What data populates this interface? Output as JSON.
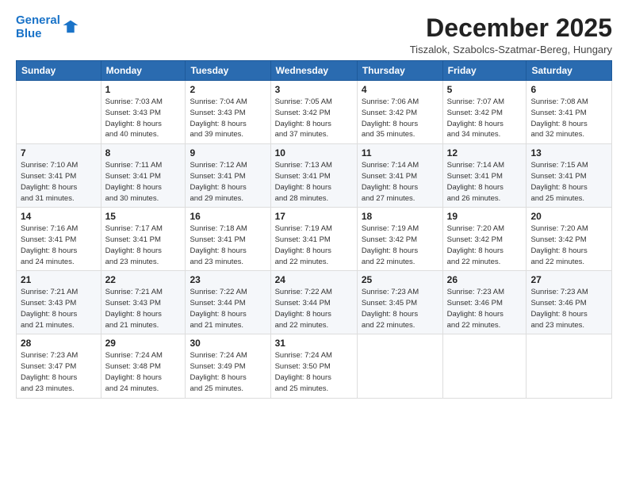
{
  "logo": {
    "line1": "General",
    "line2": "Blue"
  },
  "title": "December 2025",
  "subtitle": "Tiszalok, Szabolcs-Szatmar-Bereg, Hungary",
  "weekdays": [
    "Sunday",
    "Monday",
    "Tuesday",
    "Wednesday",
    "Thursday",
    "Friday",
    "Saturday"
  ],
  "weeks": [
    [
      {
        "day": "",
        "info": ""
      },
      {
        "day": "1",
        "info": "Sunrise: 7:03 AM\nSunset: 3:43 PM\nDaylight: 8 hours\nand 40 minutes."
      },
      {
        "day": "2",
        "info": "Sunrise: 7:04 AM\nSunset: 3:43 PM\nDaylight: 8 hours\nand 39 minutes."
      },
      {
        "day": "3",
        "info": "Sunrise: 7:05 AM\nSunset: 3:42 PM\nDaylight: 8 hours\nand 37 minutes."
      },
      {
        "day": "4",
        "info": "Sunrise: 7:06 AM\nSunset: 3:42 PM\nDaylight: 8 hours\nand 35 minutes."
      },
      {
        "day": "5",
        "info": "Sunrise: 7:07 AM\nSunset: 3:42 PM\nDaylight: 8 hours\nand 34 minutes."
      },
      {
        "day": "6",
        "info": "Sunrise: 7:08 AM\nSunset: 3:41 PM\nDaylight: 8 hours\nand 32 minutes."
      }
    ],
    [
      {
        "day": "7",
        "info": "Sunrise: 7:10 AM\nSunset: 3:41 PM\nDaylight: 8 hours\nand 31 minutes."
      },
      {
        "day": "8",
        "info": "Sunrise: 7:11 AM\nSunset: 3:41 PM\nDaylight: 8 hours\nand 30 minutes."
      },
      {
        "day": "9",
        "info": "Sunrise: 7:12 AM\nSunset: 3:41 PM\nDaylight: 8 hours\nand 29 minutes."
      },
      {
        "day": "10",
        "info": "Sunrise: 7:13 AM\nSunset: 3:41 PM\nDaylight: 8 hours\nand 28 minutes."
      },
      {
        "day": "11",
        "info": "Sunrise: 7:14 AM\nSunset: 3:41 PM\nDaylight: 8 hours\nand 27 minutes."
      },
      {
        "day": "12",
        "info": "Sunrise: 7:14 AM\nSunset: 3:41 PM\nDaylight: 8 hours\nand 26 minutes."
      },
      {
        "day": "13",
        "info": "Sunrise: 7:15 AM\nSunset: 3:41 PM\nDaylight: 8 hours\nand 25 minutes."
      }
    ],
    [
      {
        "day": "14",
        "info": "Sunrise: 7:16 AM\nSunset: 3:41 PM\nDaylight: 8 hours\nand 24 minutes."
      },
      {
        "day": "15",
        "info": "Sunrise: 7:17 AM\nSunset: 3:41 PM\nDaylight: 8 hours\nand 23 minutes."
      },
      {
        "day": "16",
        "info": "Sunrise: 7:18 AM\nSunset: 3:41 PM\nDaylight: 8 hours\nand 23 minutes."
      },
      {
        "day": "17",
        "info": "Sunrise: 7:19 AM\nSunset: 3:41 PM\nDaylight: 8 hours\nand 22 minutes."
      },
      {
        "day": "18",
        "info": "Sunrise: 7:19 AM\nSunset: 3:42 PM\nDaylight: 8 hours\nand 22 minutes."
      },
      {
        "day": "19",
        "info": "Sunrise: 7:20 AM\nSunset: 3:42 PM\nDaylight: 8 hours\nand 22 minutes."
      },
      {
        "day": "20",
        "info": "Sunrise: 7:20 AM\nSunset: 3:42 PM\nDaylight: 8 hours\nand 22 minutes."
      }
    ],
    [
      {
        "day": "21",
        "info": "Sunrise: 7:21 AM\nSunset: 3:43 PM\nDaylight: 8 hours\nand 21 minutes."
      },
      {
        "day": "22",
        "info": "Sunrise: 7:21 AM\nSunset: 3:43 PM\nDaylight: 8 hours\nand 21 minutes."
      },
      {
        "day": "23",
        "info": "Sunrise: 7:22 AM\nSunset: 3:44 PM\nDaylight: 8 hours\nand 21 minutes."
      },
      {
        "day": "24",
        "info": "Sunrise: 7:22 AM\nSunset: 3:44 PM\nDaylight: 8 hours\nand 22 minutes."
      },
      {
        "day": "25",
        "info": "Sunrise: 7:23 AM\nSunset: 3:45 PM\nDaylight: 8 hours\nand 22 minutes."
      },
      {
        "day": "26",
        "info": "Sunrise: 7:23 AM\nSunset: 3:46 PM\nDaylight: 8 hours\nand 22 minutes."
      },
      {
        "day": "27",
        "info": "Sunrise: 7:23 AM\nSunset: 3:46 PM\nDaylight: 8 hours\nand 23 minutes."
      }
    ],
    [
      {
        "day": "28",
        "info": "Sunrise: 7:23 AM\nSunset: 3:47 PM\nDaylight: 8 hours\nand 23 minutes."
      },
      {
        "day": "29",
        "info": "Sunrise: 7:24 AM\nSunset: 3:48 PM\nDaylight: 8 hours\nand 24 minutes."
      },
      {
        "day": "30",
        "info": "Sunrise: 7:24 AM\nSunset: 3:49 PM\nDaylight: 8 hours\nand 25 minutes."
      },
      {
        "day": "31",
        "info": "Sunrise: 7:24 AM\nSunset: 3:50 PM\nDaylight: 8 hours\nand 25 minutes."
      },
      {
        "day": "",
        "info": ""
      },
      {
        "day": "",
        "info": ""
      },
      {
        "day": "",
        "info": ""
      }
    ]
  ]
}
